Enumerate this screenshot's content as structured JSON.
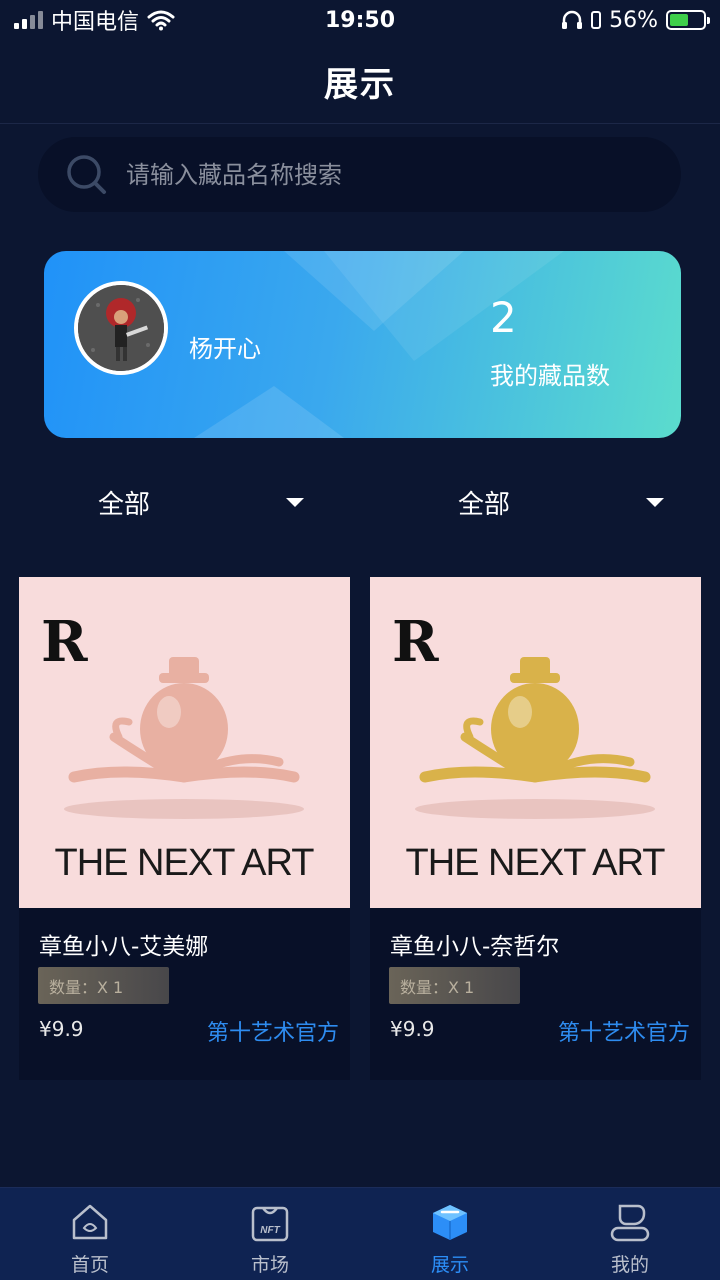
{
  "status_bar": {
    "carrier": "中国电信",
    "time": "19:50",
    "battery": "56%",
    "battery_level": 0.56
  },
  "header": {
    "title": "展示"
  },
  "search": {
    "placeholder": "请输入藏品名称搜索",
    "value": ""
  },
  "profile": {
    "name": "杨开心",
    "collection_count": "2",
    "collection_label": "我的藏品数"
  },
  "filters": [
    {
      "label": "全部"
    },
    {
      "label": "全部"
    }
  ],
  "items": [
    {
      "title": "章鱼小八-艾美娜",
      "quantity": "数量：X 1",
      "price": "¥9.9",
      "publisher": "第十艺术官方",
      "brand_text": "THE NEXT ART",
      "color": "#e8b0a2"
    },
    {
      "title": "章鱼小八-奈哲尔",
      "quantity": "数量：X 1",
      "price": "¥9.9",
      "publisher": "第十艺术官方",
      "brand_text": "THE NEXT ART",
      "color": "#d9b24a"
    }
  ],
  "tabs": [
    {
      "label": "首页",
      "icon": "home-icon",
      "active": false
    },
    {
      "label": "市场",
      "icon": "nft-bag-icon",
      "active": false
    },
    {
      "label": "展示",
      "icon": "cube-icon",
      "active": true
    },
    {
      "label": "我的",
      "icon": "user-icon",
      "active": false
    }
  ],
  "colors": {
    "background": "#0c1631",
    "accent": "#2c8ef7",
    "card_gradient_start": "#2092f8",
    "card_gradient_end": "#5bdccd"
  }
}
